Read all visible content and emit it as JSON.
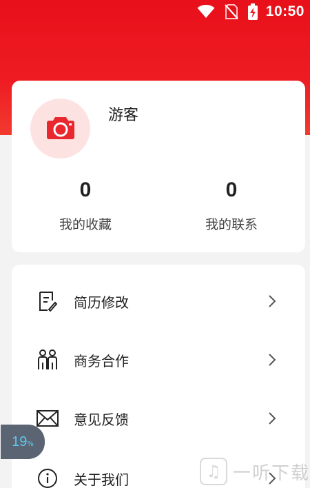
{
  "status_bar": {
    "time": "10:50",
    "icons": [
      "wifi-icon",
      "no-sim-icon",
      "battery-charging-icon"
    ]
  },
  "profile": {
    "avatar_icon": "camera-icon",
    "username": "游客",
    "stats": [
      {
        "value": "0",
        "label": "我的收藏"
      },
      {
        "value": "0",
        "label": "我的联系"
      }
    ]
  },
  "menu": {
    "items": [
      {
        "label": "简历修改",
        "icon": "resume-edit-icon"
      },
      {
        "label": "商务合作",
        "icon": "people-icon"
      },
      {
        "label": "意见反馈",
        "icon": "mail-icon"
      },
      {
        "label": "关于我们",
        "icon": "info-icon"
      }
    ]
  },
  "overlay": {
    "progress_value": "19",
    "progress_unit": "%"
  },
  "watermark": {
    "text": "一听下载"
  },
  "colors": {
    "primary_red": "#ee1c22",
    "avatar_bg": "#fde2e2",
    "progress_text": "#5ec8f0"
  }
}
